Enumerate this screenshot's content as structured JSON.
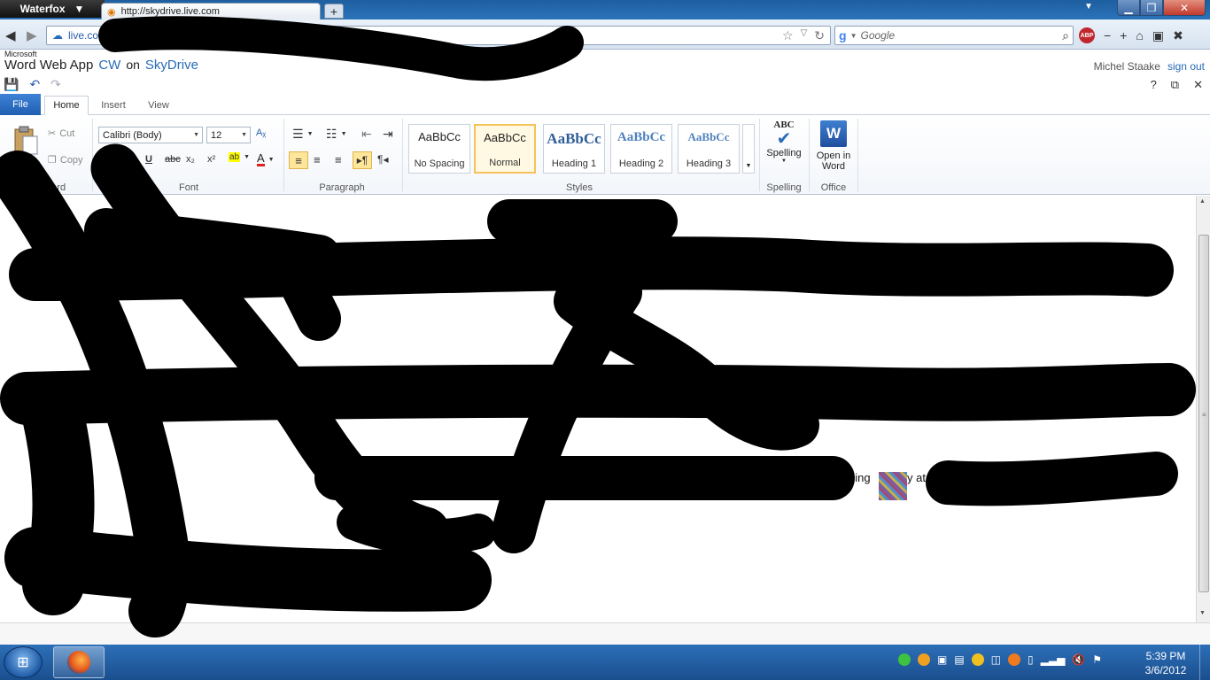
{
  "browser": {
    "app_menu": "Waterfox",
    "tab_title": "http://skydrive.live.com",
    "new_tab": "+",
    "url": "live.co",
    "search_placeholder": "Google",
    "search_logo": "g"
  },
  "owa": {
    "brand_small": "Microsoft",
    "brand_app": "Word Web App",
    "doc_name": "CW",
    "on": "on",
    "service": "SkyDrive",
    "user_name": "Michel Staake",
    "sign_out": "sign out"
  },
  "ribbon": {
    "tabs": {
      "file": "File",
      "home": "Home",
      "insert": "Insert",
      "view": "View"
    },
    "clipboard": {
      "paste": "Paste",
      "cut": "Cut",
      "copy": "Copy",
      "label": "board"
    },
    "font": {
      "name": "Calibri (Body)",
      "size": "12",
      "label": "Font",
      "underline": "U",
      "strike": "abc",
      "sub": "x₂",
      "sup": "x²",
      "highlight": "ab",
      "color": "A"
    },
    "paragraph": {
      "label": "Paragraph"
    },
    "styles": {
      "label": "Styles",
      "items": [
        {
          "sample": "AaBbCc",
          "name": "No Spacing"
        },
        {
          "sample": "AaBbCc",
          "name": "Normal"
        },
        {
          "sample": "AaBbCc",
          "name": "Heading 1"
        },
        {
          "sample": "AaBbCc",
          "name": "Heading 2"
        },
        {
          "sample": "AaBbCc",
          "name": "Heading 3"
        }
      ]
    },
    "spelling": {
      "abc": "ABC",
      "button": "Spelling",
      "label": "Spelling"
    },
    "office": {
      "button_line1": "Open in",
      "button_line2": "Word",
      "label": "Office"
    }
  },
  "document": {
    "fragment1": "oing",
    "fragment2": "y at"
  },
  "taskbar": {
    "time": "5:39 PM",
    "date": "3/6/2012"
  },
  "colors": {
    "accent": "#2a6cb8",
    "file_tab": "#1f5fb2",
    "taskbar": "#1a4f8e"
  }
}
